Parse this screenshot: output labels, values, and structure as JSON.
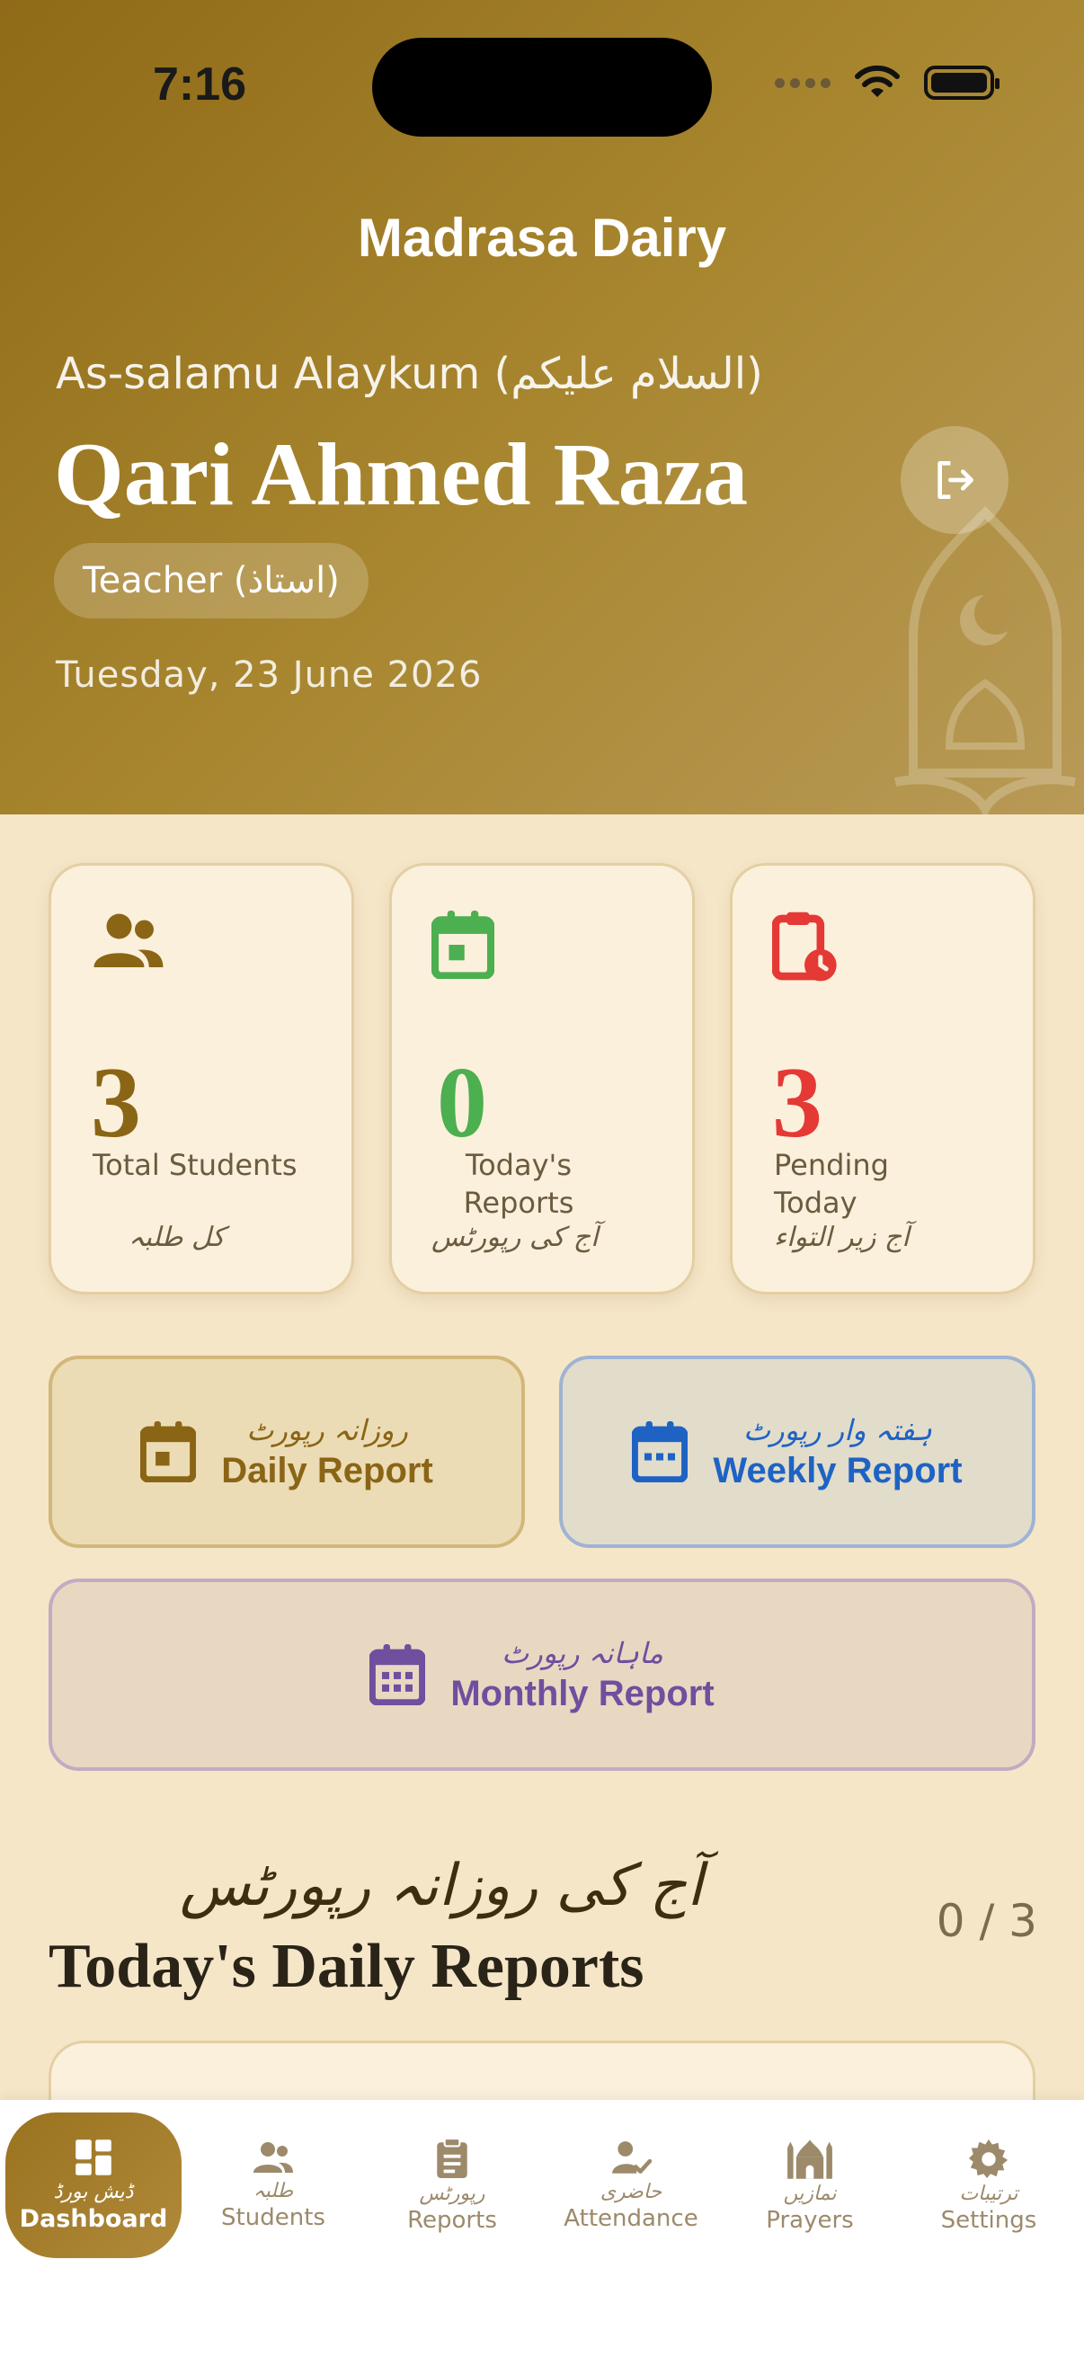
{
  "status_bar": {
    "time": "7:16"
  },
  "header": {
    "app_title": "Madrasa Dairy",
    "greeting": "As-salamu Alaykum (السلام علیکم)",
    "teacher_name": "Qari Ahmed Raza",
    "role": "Teacher (استاذ)",
    "date": "Tuesday, 23 June 2026"
  },
  "stats": [
    {
      "value": "3",
      "label": "Total Students",
      "urdu": "کل طلبہ",
      "color": "#8a6516"
    },
    {
      "value": "0",
      "label": "Today's Reports",
      "urdu": "آج کی رپورٹس",
      "color": "#4caf50"
    },
    {
      "value": "3",
      "label": "Pending Today",
      "urdu": "آج زیر التواء",
      "color": "#e53935"
    }
  ],
  "report_buttons": {
    "daily": {
      "urdu": "روزانہ رپورٹ",
      "label": "Daily Report",
      "color": "#8a6516"
    },
    "weekly": {
      "urdu": "ہفتہ وار رپورٹ",
      "label": "Weekly Report",
      "color": "#1e63c4"
    },
    "monthly": {
      "urdu": "ماہانہ رپورٹ",
      "label": "Monthly Report",
      "color": "#6f4f9e"
    }
  },
  "section": {
    "urdu_title": "آج کی روزانہ رپورٹس",
    "title": "Today's Daily Reports",
    "count": "0 / 3"
  },
  "nav": [
    {
      "urdu": "ڈیش بورڈ",
      "label": "Dashboard",
      "icon": "dashboard-icon",
      "active": true
    },
    {
      "urdu": "طلبہ",
      "label": "Students",
      "icon": "students-icon"
    },
    {
      "urdu": "رپورٹس",
      "label": "Reports",
      "icon": "clipboard-icon"
    },
    {
      "urdu": "حاضری",
      "label": "Attendance",
      "icon": "attendance-icon"
    },
    {
      "urdu": "نمازیں",
      "label": "Prayers",
      "icon": "mosque-icon"
    },
    {
      "urdu": "ترتیبات",
      "label": "Settings",
      "icon": "gear-icon"
    }
  ]
}
